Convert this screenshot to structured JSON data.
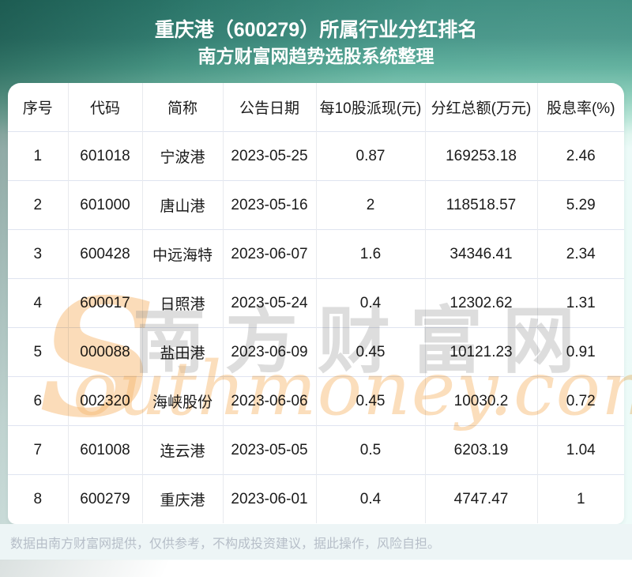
{
  "header": {
    "title": "重庆港（600279）所属行业分红排名",
    "subtitle": "南方财富网趋势选股系统整理"
  },
  "table": {
    "columns": [
      "序号",
      "代码",
      "简称",
      "公告日期",
      "每10股派现(元)",
      "分红总额(万元)",
      "股息率(%)"
    ],
    "rows": [
      [
        "1",
        "601018",
        "宁波港",
        "2023-05-25",
        "0.87",
        "169253.18",
        "2.46"
      ],
      [
        "2",
        "601000",
        "唐山港",
        "2023-05-16",
        "2",
        "118518.57",
        "5.29"
      ],
      [
        "3",
        "600428",
        "中远海特",
        "2023-06-07",
        "1.6",
        "34346.41",
        "2.34"
      ],
      [
        "4",
        "600017",
        "日照港",
        "2023-05-24",
        "0.4",
        "12302.62",
        "1.31"
      ],
      [
        "5",
        "000088",
        "盐田港",
        "2023-06-09",
        "0.45",
        "10121.23",
        "0.91"
      ],
      [
        "6",
        "002320",
        "海峡股份",
        "2023-06-06",
        "0.45",
        "10030.2",
        "0.72"
      ],
      [
        "7",
        "601008",
        "连云港",
        "2023-05-05",
        "0.5",
        "6203.19",
        "1.04"
      ],
      [
        "8",
        "600279",
        "重庆港",
        "2023-06-01",
        "0.4",
        "4747.47",
        "1"
      ]
    ]
  },
  "watermark": {
    "s": "S",
    "cn": "南方财富网",
    "en": "outhmoney.com"
  },
  "footer": {
    "disclaimer": "数据由南方财富网提供，仅供参考，不构成投资建议，据此操作，风险自担。"
  },
  "colors": {
    "banner_teal_dark": "#2a7c6e",
    "banner_teal_light": "#9ddcc8",
    "page_background": "#eefbf9",
    "watermark_orange": "#f7ba73",
    "watermark_gray": "#949494",
    "row_divider": "#dfe4f0",
    "column_divider": "#e8eaee",
    "footer_text": "#b6bec8",
    "footer_band": "#edf5f6"
  }
}
